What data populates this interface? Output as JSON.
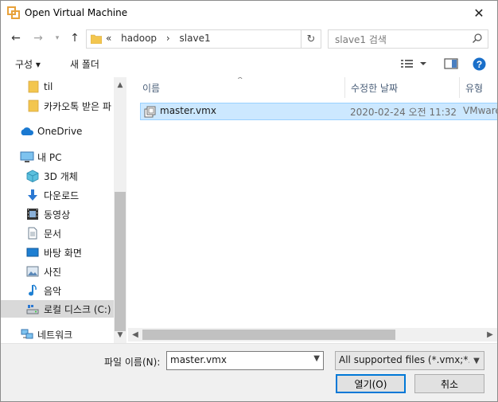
{
  "window": {
    "title": "Open Virtual Machine",
    "close": "✕"
  },
  "address": {
    "prefix": "«",
    "crumbs": [
      "hadoop",
      "›",
      "slave1"
    ]
  },
  "search": {
    "placeholder": "slave1 검색"
  },
  "toolbar": {
    "organize": "구성 ▾",
    "new_folder": "새 폴더"
  },
  "nav": {
    "items": [
      {
        "label": "til",
        "icon": "folder-icon"
      },
      {
        "label": "카카오톡 받은 파",
        "icon": "folder-icon"
      },
      {
        "label": "OneDrive",
        "icon": "cloud-icon"
      },
      {
        "label": "내 PC",
        "icon": "pc-icon"
      },
      {
        "label": "3D 개체",
        "icon": "cube-icon"
      },
      {
        "label": "다운로드",
        "icon": "download-icon"
      },
      {
        "label": "동영상",
        "icon": "video-icon"
      },
      {
        "label": "문서",
        "icon": "document-icon"
      },
      {
        "label": "바탕 화면",
        "icon": "desktop-icon"
      },
      {
        "label": "사진",
        "icon": "picture-icon"
      },
      {
        "label": "음악",
        "icon": "music-icon"
      },
      {
        "label": "로컬 디스크 (C:)",
        "icon": "drive-icon"
      },
      {
        "label": "네트워크",
        "icon": "network-icon"
      }
    ]
  },
  "columns": {
    "name": "이름",
    "date": "수정한 날짜",
    "type": "유형"
  },
  "files": [
    {
      "name": "master.vmx",
      "date": "2020-02-24 오전 11:32",
      "type": "VMware"
    }
  ],
  "bottom": {
    "filename_label": "파일 이름(N):",
    "filename_value": "master.vmx",
    "filetype_value": "All supported files (*.vmx;*.ovf",
    "open_button": "열기(O)",
    "cancel_button": "취소"
  },
  "colors": {
    "selection": "#cce8ff",
    "accent": "#0078d7",
    "help": "#1a6fc9"
  }
}
